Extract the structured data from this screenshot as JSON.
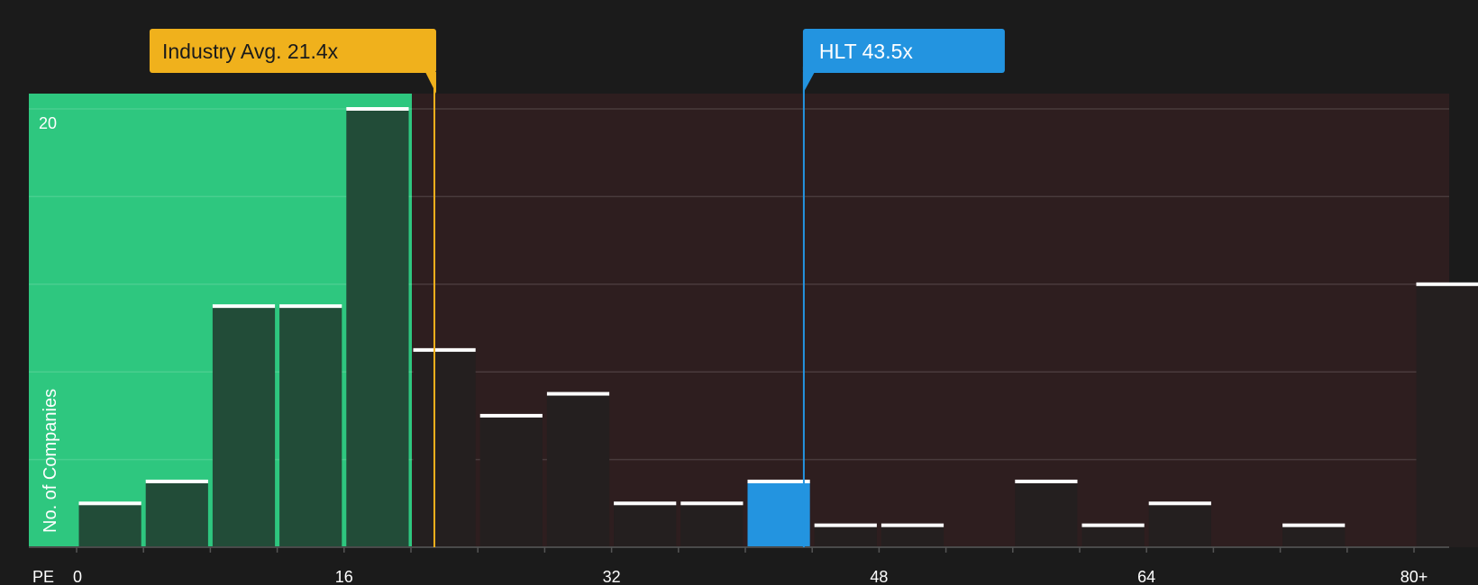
{
  "chart_data": {
    "type": "bar",
    "xlabel": "PE",
    "ylabel": "No. of Companies",
    "x_ticks": [
      "0",
      "16",
      "32",
      "48",
      "64",
      "80+"
    ],
    "y_ticks": [
      "20"
    ],
    "ylim": [
      0,
      20
    ],
    "bin_width": 4,
    "bins": [
      {
        "x": 0,
        "count": 2
      },
      {
        "x": 4,
        "count": 3
      },
      {
        "x": 8,
        "count": 11
      },
      {
        "x": 12,
        "count": 11
      },
      {
        "x": 16,
        "count": 20
      },
      {
        "x": 20,
        "count": 9
      },
      {
        "x": 24,
        "count": 6
      },
      {
        "x": 28,
        "count": 7
      },
      {
        "x": 32,
        "count": 2
      },
      {
        "x": 36,
        "count": 2
      },
      {
        "x": 40,
        "count": 3
      },
      {
        "x": 44,
        "count": 1
      },
      {
        "x": 48,
        "count": 1
      },
      {
        "x": 52,
        "count": 0
      },
      {
        "x": 56,
        "count": 3
      },
      {
        "x": 60,
        "count": 1
      },
      {
        "x": 64,
        "count": 2
      },
      {
        "x": 68,
        "count": 0
      },
      {
        "x": 72,
        "count": 1
      },
      {
        "x": 76,
        "count": 0
      },
      {
        "x": 80,
        "count": 12
      }
    ],
    "highlight_bin_x": 40,
    "fair_range_max": 20,
    "industry_avg": {
      "label": "Industry Avg. 21.4x",
      "value": 21.4
    },
    "company": {
      "label": "HLT 43.5x",
      "value": 43.5
    },
    "grid": true,
    "colors": {
      "background": "#1b1b1b",
      "fair_region": "#2ec77f",
      "expensive_region": "#2e1e1f",
      "bar_in_fair": "#224c38",
      "bar_default": "#241f1f",
      "bar_highlight": "#2394e0",
      "industry_callout": "#f0b11c",
      "company_callout": "#2394e0",
      "bar_cap": "#ffffff"
    }
  }
}
